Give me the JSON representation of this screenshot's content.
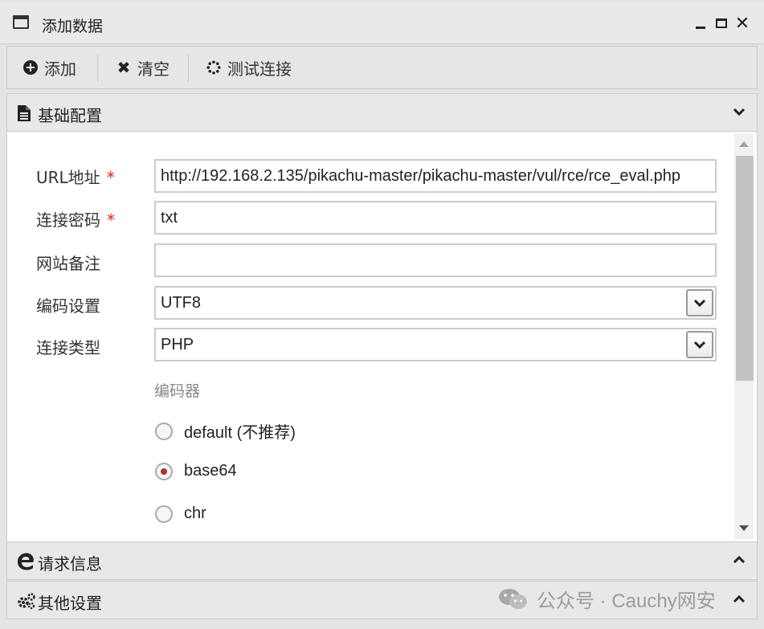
{
  "window": {
    "title": "添加数据"
  },
  "toolbar": {
    "add_label": "添加",
    "clear_label": "清空",
    "test_label": "测试连接"
  },
  "sections": {
    "basic": "基础配置",
    "request": "请求信息",
    "other": "其他设置"
  },
  "form": {
    "url": {
      "label": "URL地址",
      "required": "*",
      "value": "http://192.168.2.135/pikachu-master/pikachu-master/vul/rce/rce_eval.php"
    },
    "password": {
      "label": "连接密码",
      "required": "*",
      "value": "txt"
    },
    "note": {
      "label": "网站备注",
      "value": ""
    },
    "encoding": {
      "label": "编码设置",
      "value": "UTF8"
    },
    "type": {
      "label": "连接类型",
      "value": "PHP"
    }
  },
  "encoder": {
    "title": "编码器",
    "options": [
      "default (不推荐)",
      "base64",
      "chr"
    ],
    "selected": "base64"
  },
  "watermark": "公众号 · Cauchy网安"
}
